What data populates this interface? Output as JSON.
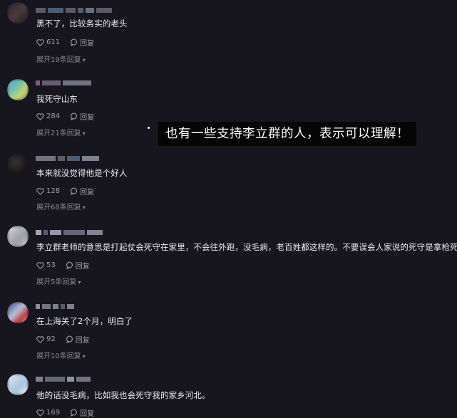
{
  "comments": [
    {
      "text": "黑不了，比较务实的老头",
      "likes": "611",
      "reply_label": "回复",
      "expand": "展开19条回复"
    },
    {
      "text": "我死守山东",
      "likes": "284",
      "reply_label": "回复",
      "expand": "展开21条回复"
    },
    {
      "text": "本来就没觉得他是个好人",
      "likes": "128",
      "reply_label": "回复",
      "expand": "展开68条回复"
    },
    {
      "text": "李立群老师的意思是打起仗会死守在家里，不会往外跑，没毛病，老百姓都这样的。不要误会人家说的死守是拿枪死守",
      "likes": "53",
      "reply_label": "回复",
      "expand": "展开5条回复"
    },
    {
      "text": "在上海关了2个月，明白了",
      "likes": "92",
      "reply_label": "回复",
      "expand": "展开10条回复"
    },
    {
      "text": "他的话没毛病，比如我也会死守我的家乡河北。",
      "likes": "169",
      "reply_label": "回复",
      "expand": ""
    }
  ],
  "banner": {
    "text": "也有一些支持李立群的人，表示可以理解！"
  },
  "icons": {
    "like": "heart-icon",
    "reply": "speech-bubble-icon",
    "expand": "chevron-down-icon",
    "emoji": "laughing-emoji-icon"
  },
  "colors": {
    "background": "#17161f",
    "text": "#ececf0",
    "meta": "#9e9da8",
    "banner_bg": "#050505"
  }
}
